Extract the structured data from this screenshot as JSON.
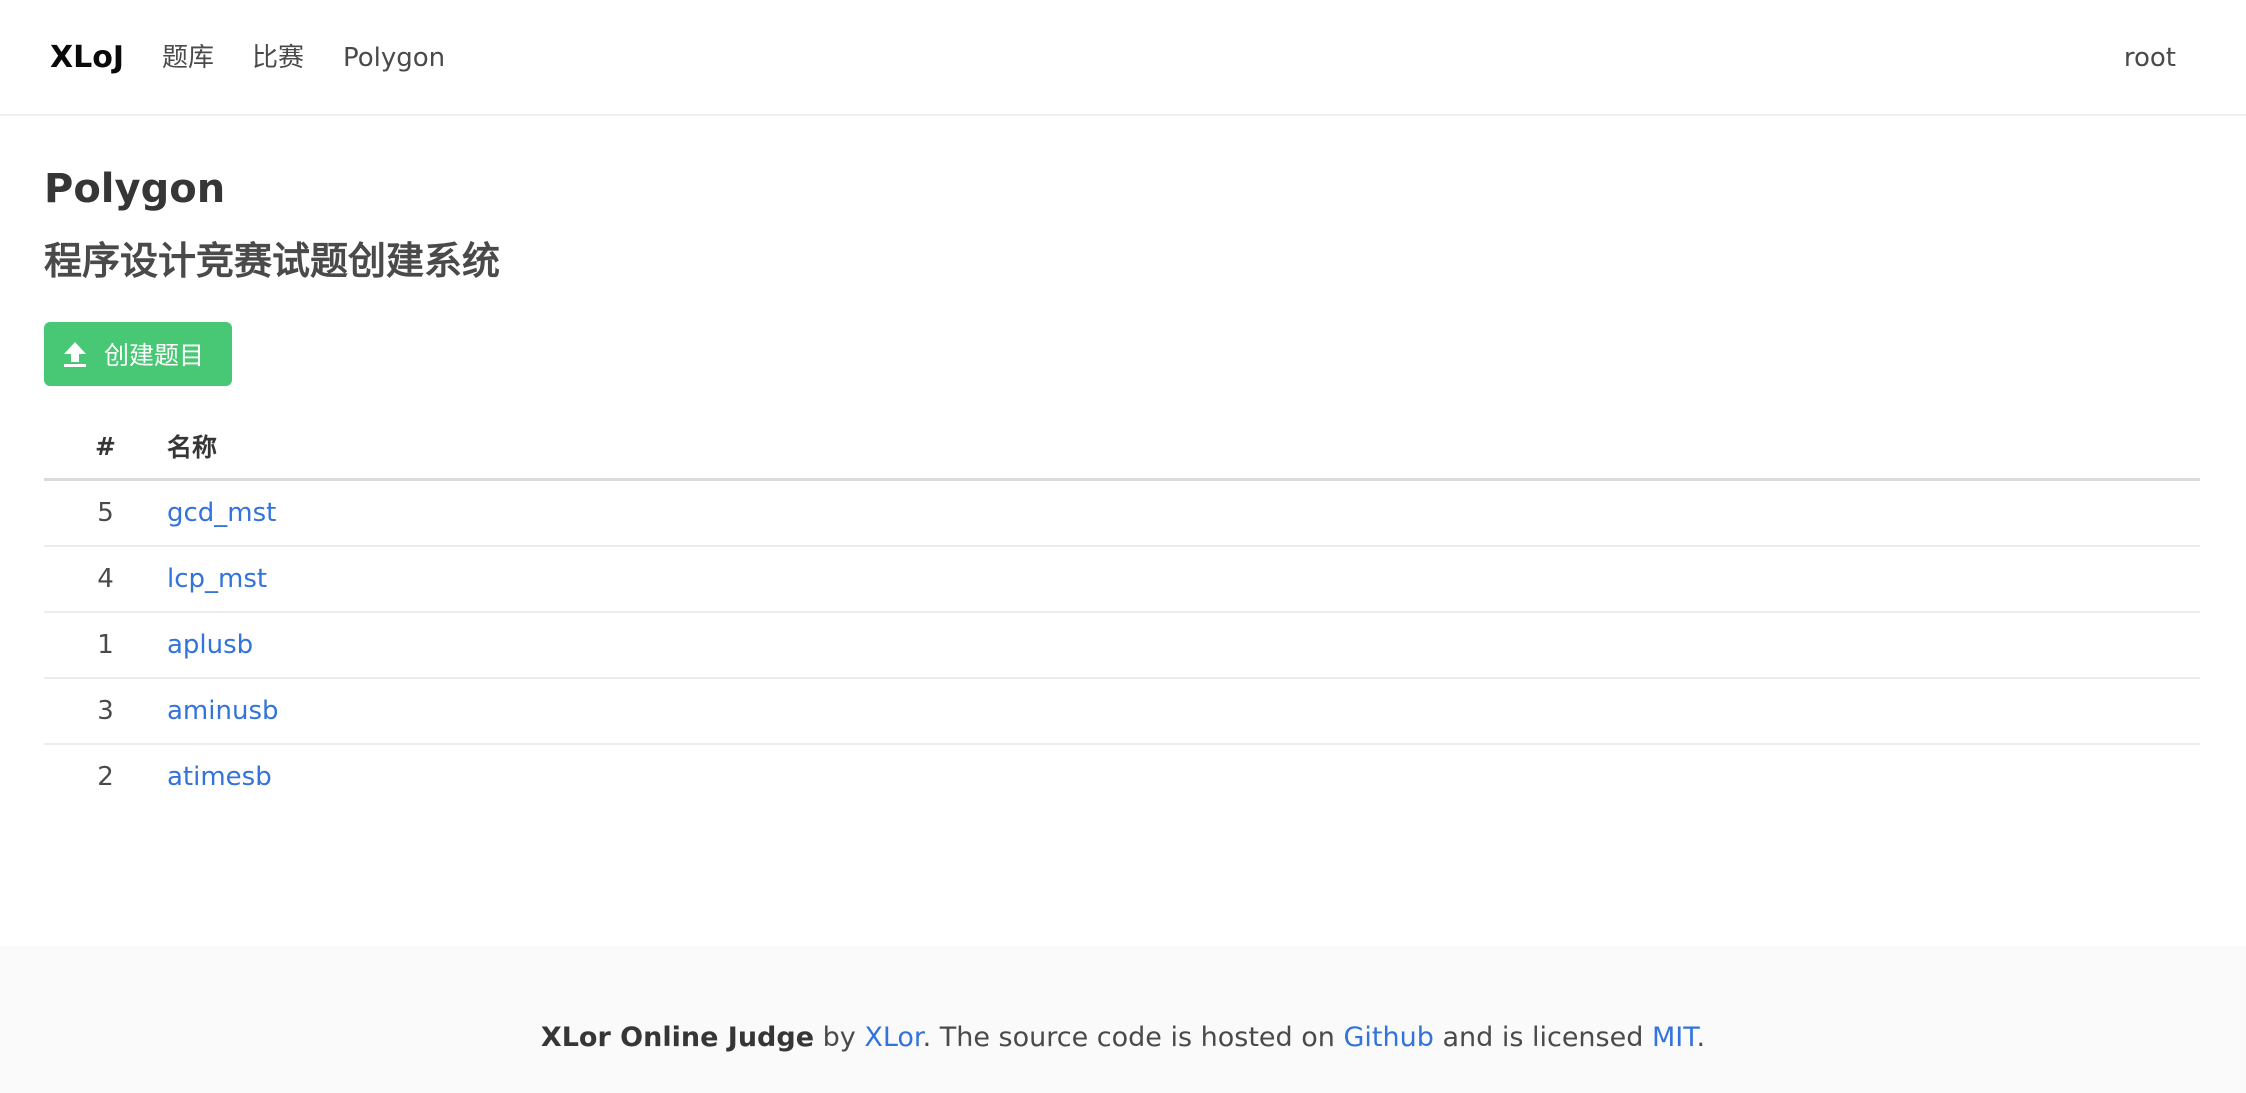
{
  "navbar": {
    "brand": "XLoJ",
    "items": [
      {
        "label": "题库"
      },
      {
        "label": "比赛"
      },
      {
        "label": "Polygon"
      }
    ],
    "user": "root"
  },
  "main": {
    "title": "Polygon",
    "subtitle": "程序设计竞赛试题创建系统",
    "create_button_label": "创建题目",
    "create_button_icon": "upload-icon"
  },
  "table": {
    "headers": {
      "id": "#",
      "name": "名称"
    },
    "rows": [
      {
        "id": "5",
        "name": "gcd_mst"
      },
      {
        "id": "4",
        "name": "lcp_mst"
      },
      {
        "id": "1",
        "name": "aplusb"
      },
      {
        "id": "3",
        "name": "aminusb"
      },
      {
        "id": "2",
        "name": "atimesb"
      }
    ]
  },
  "footer": {
    "project": "XLor Online Judge",
    "by": "by",
    "author": "XLor",
    "hosted": ". The source code is hosted on",
    "github": "Github",
    "licensed": "and is licensed",
    "license": "MIT",
    "end": "."
  },
  "colors": {
    "primary_success": "#48c774",
    "link": "#3273dc",
    "footer_bg": "#fafafa"
  }
}
